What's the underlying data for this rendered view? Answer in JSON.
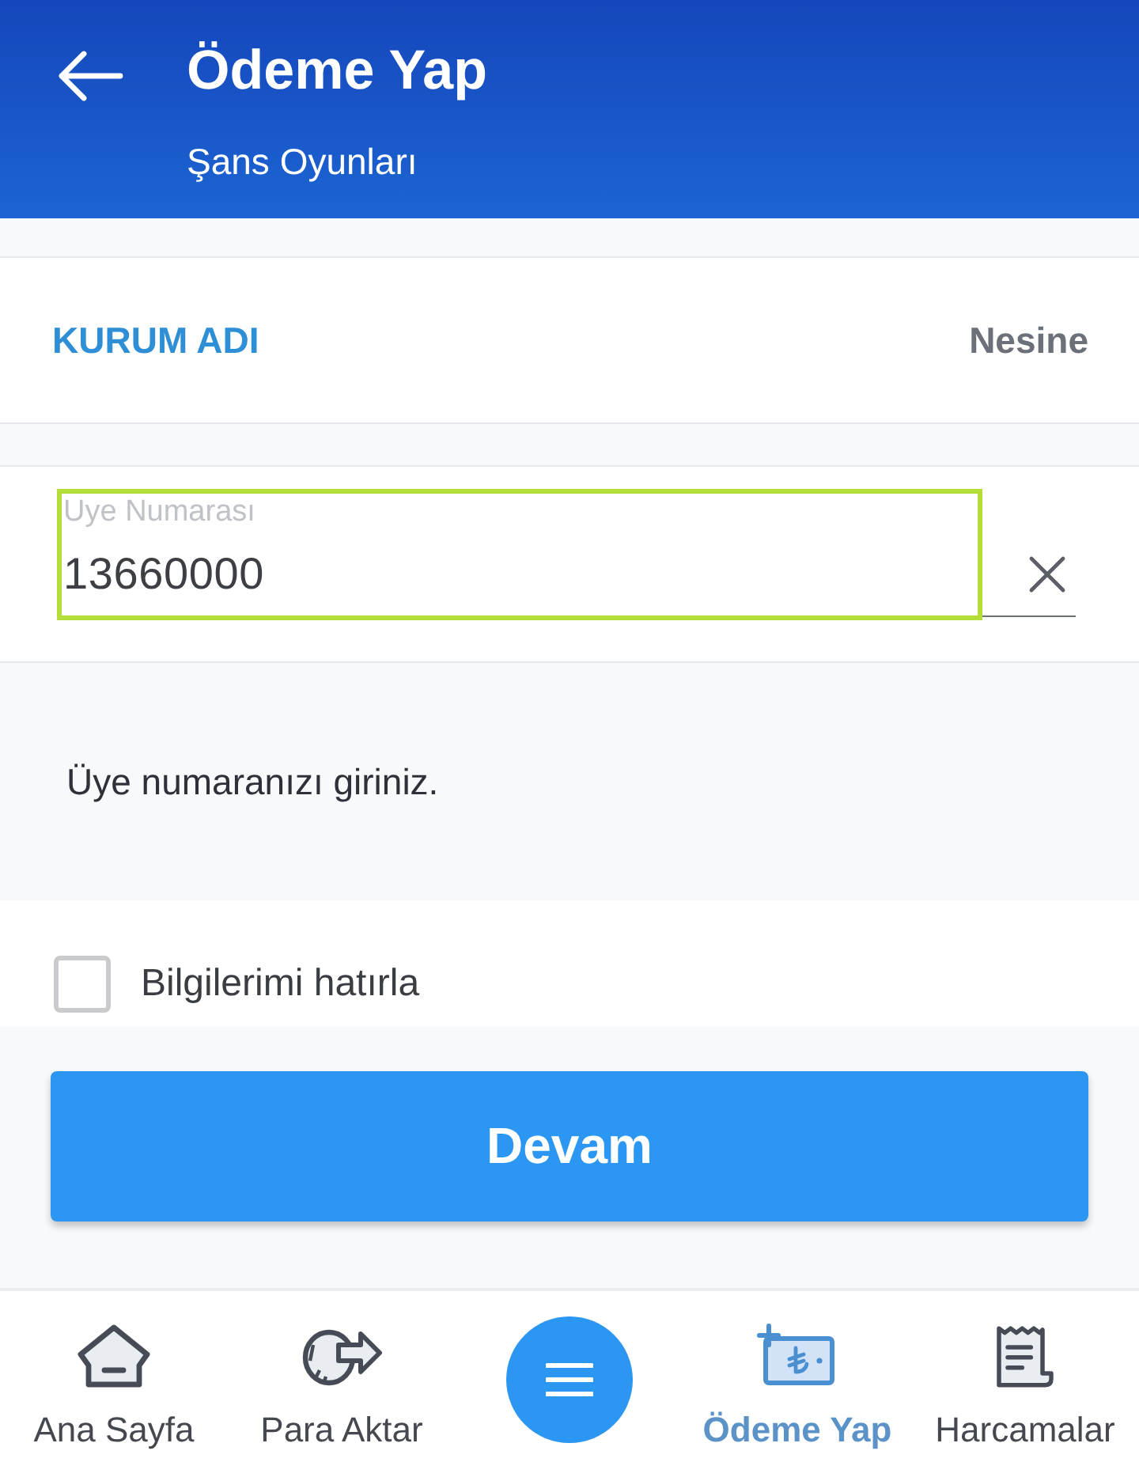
{
  "header": {
    "title": "Ödeme Yap",
    "subtitle": "Şans Oyunları"
  },
  "institution": {
    "label": "KURUM ADI",
    "value": "Nesine"
  },
  "member_field": {
    "label": "Uye Numarası",
    "value": "13660000",
    "highlighted": true
  },
  "hint": "Üye numaranızı giriniz.",
  "remember": {
    "label": "Bilgilerimi hatırla",
    "checked": false
  },
  "primary_button": "Devam",
  "bottom_nav": [
    {
      "kind": "home",
      "label": "Ana Sayfa",
      "selected": false
    },
    {
      "kind": "transfer",
      "label": "Para Aktar",
      "selected": false
    },
    {
      "kind": "menu",
      "selected": false
    },
    {
      "kind": "payment",
      "label": "Ödeme Yap",
      "selected": true
    },
    {
      "kind": "receipt",
      "label": "Harcamalar",
      "selected": false
    }
  ]
}
